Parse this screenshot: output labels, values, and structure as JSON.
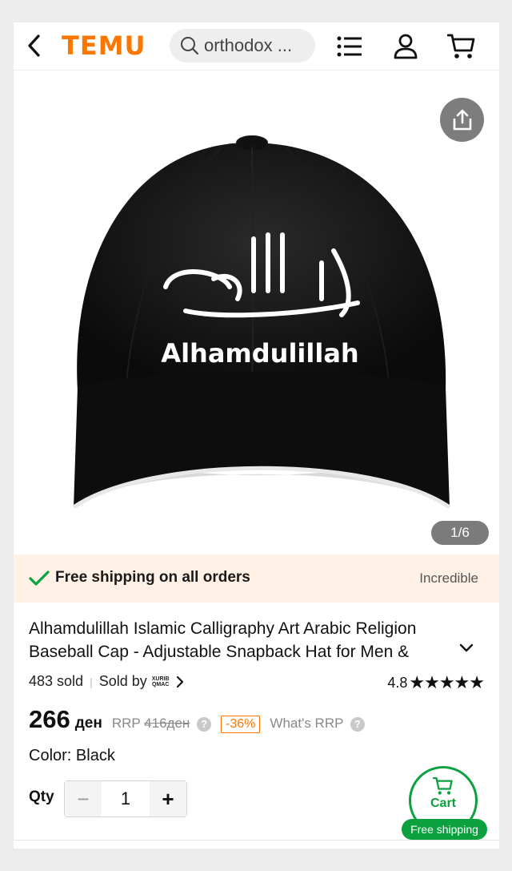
{
  "header": {
    "logo": "TEMU",
    "search_text": "orthodox ..."
  },
  "gallery": {
    "image_text": "Alhamdulillah",
    "counter": "1/6"
  },
  "shipping": {
    "label": "Free shipping on all orders",
    "right_label": "Incredible"
  },
  "product": {
    "title": "Alhamdulillah Islamic Calligraphy Art Arabic Religion Baseball Cap - Adjustable Snapback Hat for Men &",
    "sold": "483 sold",
    "sold_by": "Sold by",
    "brand_line1": "XURIB",
    "brand_line2": "QMAC",
    "rating": "4.8",
    "stars": "★★★★★",
    "price": "266",
    "currency": "ден",
    "rrp_label": "RRP",
    "rrp_value": "416ден",
    "discount": "-36%",
    "whats_rrp": "What's RRP",
    "color": "Color: Black",
    "qty_label": "Qty",
    "qty_value": "1",
    "cart_label": "Cart",
    "free_shipping_badge": "Free shipping"
  },
  "colors": {
    "brand": "#fb7701",
    "green": "#0aa13e"
  }
}
